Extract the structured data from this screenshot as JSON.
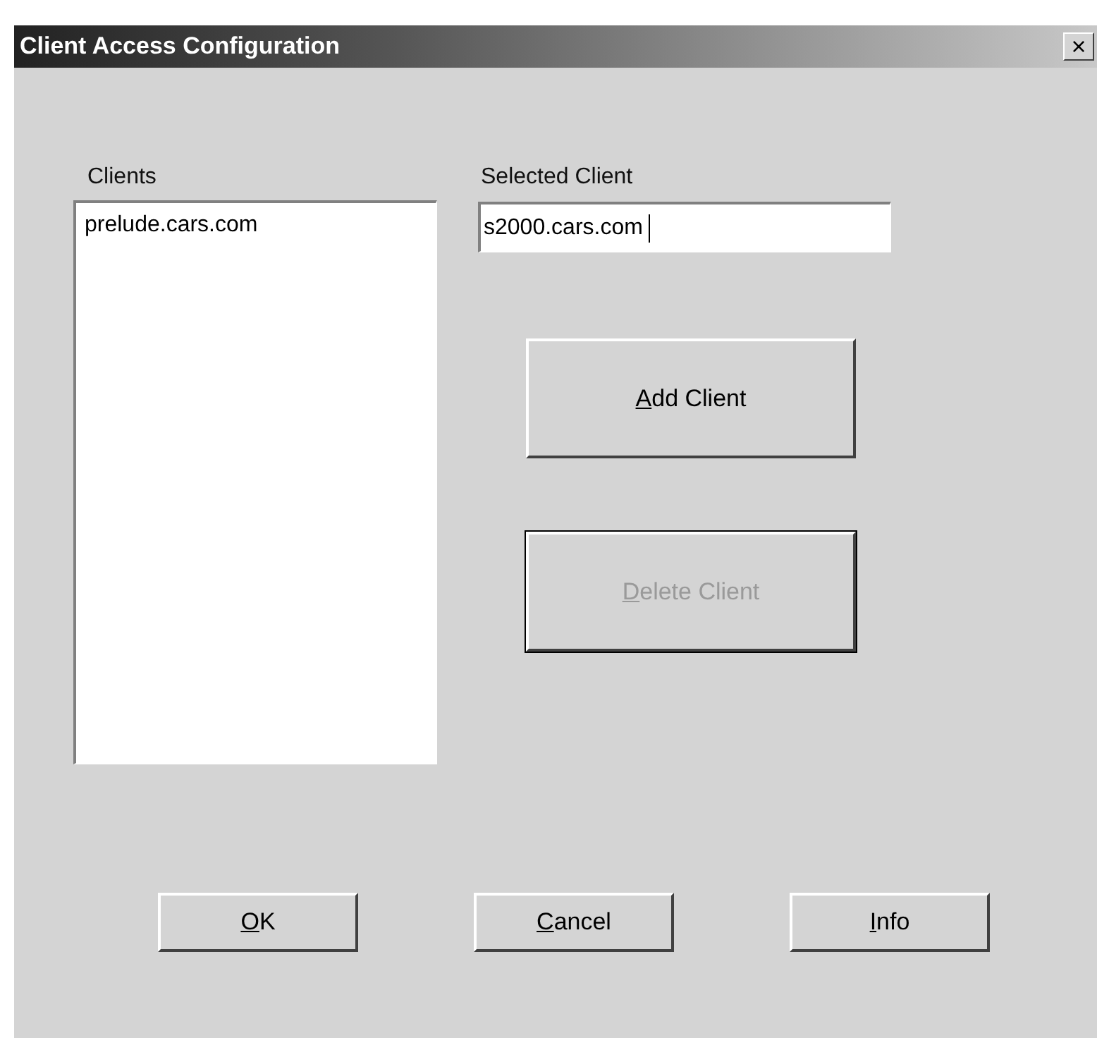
{
  "window": {
    "title": "Client Access Configuration",
    "close": "×"
  },
  "clients": {
    "label": "Clients",
    "items": [
      {
        "text": "prelude.cars.com",
        "selected": false
      }
    ]
  },
  "selected_client": {
    "label": "Selected Client",
    "value": "s2000.cars.com "
  },
  "actions": [
    {
      "access_key": "A",
      "label_rest": "dd Client",
      "disabled": false,
      "default": false
    },
    {
      "access_key": "D",
      "label_rest": "elete Client",
      "disabled": true,
      "default": true
    }
  ],
  "buttons": [
    {
      "access_key": "O",
      "label_rest": "K"
    },
    {
      "access_key": "C",
      "label_rest": "ancel"
    },
    {
      "access_key": "I",
      "label_rest": "nfo"
    }
  ]
}
